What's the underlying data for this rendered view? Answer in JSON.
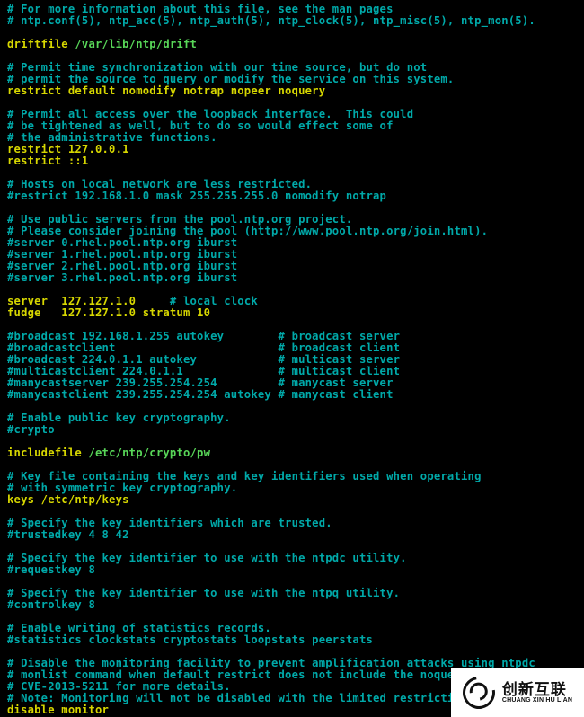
{
  "lines": [
    [
      {
        "cls": "c",
        "text": "# For more information about this file, see the man pages"
      }
    ],
    [
      {
        "cls": "c",
        "text": "# ntp.conf(5), ntp_acc(5), ntp_auth(5), ntp_clock(5), ntp_misc(5), ntp_mon(5)."
      }
    ],
    [
      {
        "cls": "c",
        "text": ""
      }
    ],
    [
      {
        "cls": "kw",
        "text": "driftfile "
      },
      {
        "cls": "vg",
        "text": "/var/lib/ntp/drift"
      }
    ],
    [
      {
        "cls": "c",
        "text": ""
      }
    ],
    [
      {
        "cls": "c",
        "text": "# Permit time synchronization with our time source, but do not"
      }
    ],
    [
      {
        "cls": "c",
        "text": "# permit the source to query or modify the service on this system."
      }
    ],
    [
      {
        "cls": "kw",
        "text": "restrict default nomodify notrap nopeer noquery"
      }
    ],
    [
      {
        "cls": "c",
        "text": ""
      }
    ],
    [
      {
        "cls": "c",
        "text": "# Permit all access over the loopback interface.  This could"
      }
    ],
    [
      {
        "cls": "c",
        "text": "# be tightened as well, but to do so would effect some of"
      }
    ],
    [
      {
        "cls": "c",
        "text": "# the administrative functions."
      }
    ],
    [
      {
        "cls": "kw",
        "text": "restrict 127.0.0.1"
      }
    ],
    [
      {
        "cls": "kw",
        "text": "restrict ::1"
      }
    ],
    [
      {
        "cls": "c",
        "text": ""
      }
    ],
    [
      {
        "cls": "c",
        "text": "# Hosts on local network are less restricted."
      }
    ],
    [
      {
        "cls": "c",
        "text": "#restrict 192.168.1.0 mask 255.255.255.0 nomodify notrap"
      }
    ],
    [
      {
        "cls": "c",
        "text": ""
      }
    ],
    [
      {
        "cls": "c",
        "text": "# Use public servers from the pool.ntp.org project."
      }
    ],
    [
      {
        "cls": "c",
        "text": "# Please consider joining the pool (http://www.pool.ntp.org/join.html)."
      }
    ],
    [
      {
        "cls": "c",
        "text": "#server 0.rhel.pool.ntp.org iburst"
      }
    ],
    [
      {
        "cls": "c",
        "text": "#server 1.rhel.pool.ntp.org iburst"
      }
    ],
    [
      {
        "cls": "c",
        "text": "#server 2.rhel.pool.ntp.org iburst"
      }
    ],
    [
      {
        "cls": "c",
        "text": "#server 3.rhel.pool.ntp.org iburst"
      }
    ],
    [
      {
        "cls": "c",
        "text": ""
      }
    ],
    [
      {
        "cls": "kw",
        "text": "server  127.127.1.0     "
      },
      {
        "cls": "c",
        "text": "# local clock"
      }
    ],
    [
      {
        "cls": "kw",
        "text": "fudge   127.127.1.0 stratum 10"
      }
    ],
    [
      {
        "cls": "c",
        "text": ""
      }
    ],
    [
      {
        "cls": "c",
        "text": "#broadcast 192.168.1.255 autokey        # broadcast server"
      }
    ],
    [
      {
        "cls": "c",
        "text": "#broadcastclient                        # broadcast client"
      }
    ],
    [
      {
        "cls": "c",
        "text": "#broadcast 224.0.1.1 autokey            # multicast server"
      }
    ],
    [
      {
        "cls": "c",
        "text": "#multicastclient 224.0.1.1              # multicast client"
      }
    ],
    [
      {
        "cls": "c",
        "text": "#manycastserver 239.255.254.254         # manycast server"
      }
    ],
    [
      {
        "cls": "c",
        "text": "#manycastclient 239.255.254.254 autokey # manycast client"
      }
    ],
    [
      {
        "cls": "c",
        "text": ""
      }
    ],
    [
      {
        "cls": "c",
        "text": "# Enable public key cryptography."
      }
    ],
    [
      {
        "cls": "c",
        "text": "#crypto"
      }
    ],
    [
      {
        "cls": "c",
        "text": ""
      }
    ],
    [
      {
        "cls": "kw",
        "text": "includefile "
      },
      {
        "cls": "vg",
        "text": "/etc/ntp/crypto/pw"
      }
    ],
    [
      {
        "cls": "c",
        "text": ""
      }
    ],
    [
      {
        "cls": "c",
        "text": "# Key file containing the keys and key identifiers used when operating"
      }
    ],
    [
      {
        "cls": "c",
        "text": "# with symmetric key cryptography."
      }
    ],
    [
      {
        "cls": "kw",
        "text": "keys /etc/ntp/keys"
      }
    ],
    [
      {
        "cls": "c",
        "text": ""
      }
    ],
    [
      {
        "cls": "c",
        "text": "# Specify the key identifiers which are trusted."
      }
    ],
    [
      {
        "cls": "c",
        "text": "#trustedkey 4 8 42"
      }
    ],
    [
      {
        "cls": "c",
        "text": ""
      }
    ],
    [
      {
        "cls": "c",
        "text": "# Specify the key identifier to use with the ntpdc utility."
      }
    ],
    [
      {
        "cls": "c",
        "text": "#requestkey 8"
      }
    ],
    [
      {
        "cls": "c",
        "text": ""
      }
    ],
    [
      {
        "cls": "c",
        "text": "# Specify the key identifier to use with the ntpq utility."
      }
    ],
    [
      {
        "cls": "c",
        "text": "#controlkey 8"
      }
    ],
    [
      {
        "cls": "c",
        "text": ""
      }
    ],
    [
      {
        "cls": "c",
        "text": "# Enable writing of statistics records."
      }
    ],
    [
      {
        "cls": "c",
        "text": "#statistics clockstats cryptostats loopstats peerstats"
      }
    ],
    [
      {
        "cls": "c",
        "text": ""
      }
    ],
    [
      {
        "cls": "c",
        "text": "# Disable the monitoring facility to prevent amplification attacks using ntpdc"
      }
    ],
    [
      {
        "cls": "c",
        "text": "# monlist command when default restrict does not include the noquery flag. See"
      }
    ],
    [
      {
        "cls": "c",
        "text": "# CVE-2013-5211 for more details."
      }
    ],
    [
      {
        "cls": "c",
        "text": "# Note: Monitoring will not be disabled with the limited restriction flag."
      }
    ],
    [
      {
        "cls": "kw",
        "text": "disable monitor"
      }
    ]
  ],
  "logo": {
    "cn": "创新互联",
    "en": "CHUANG XIN HU LIAN"
  }
}
